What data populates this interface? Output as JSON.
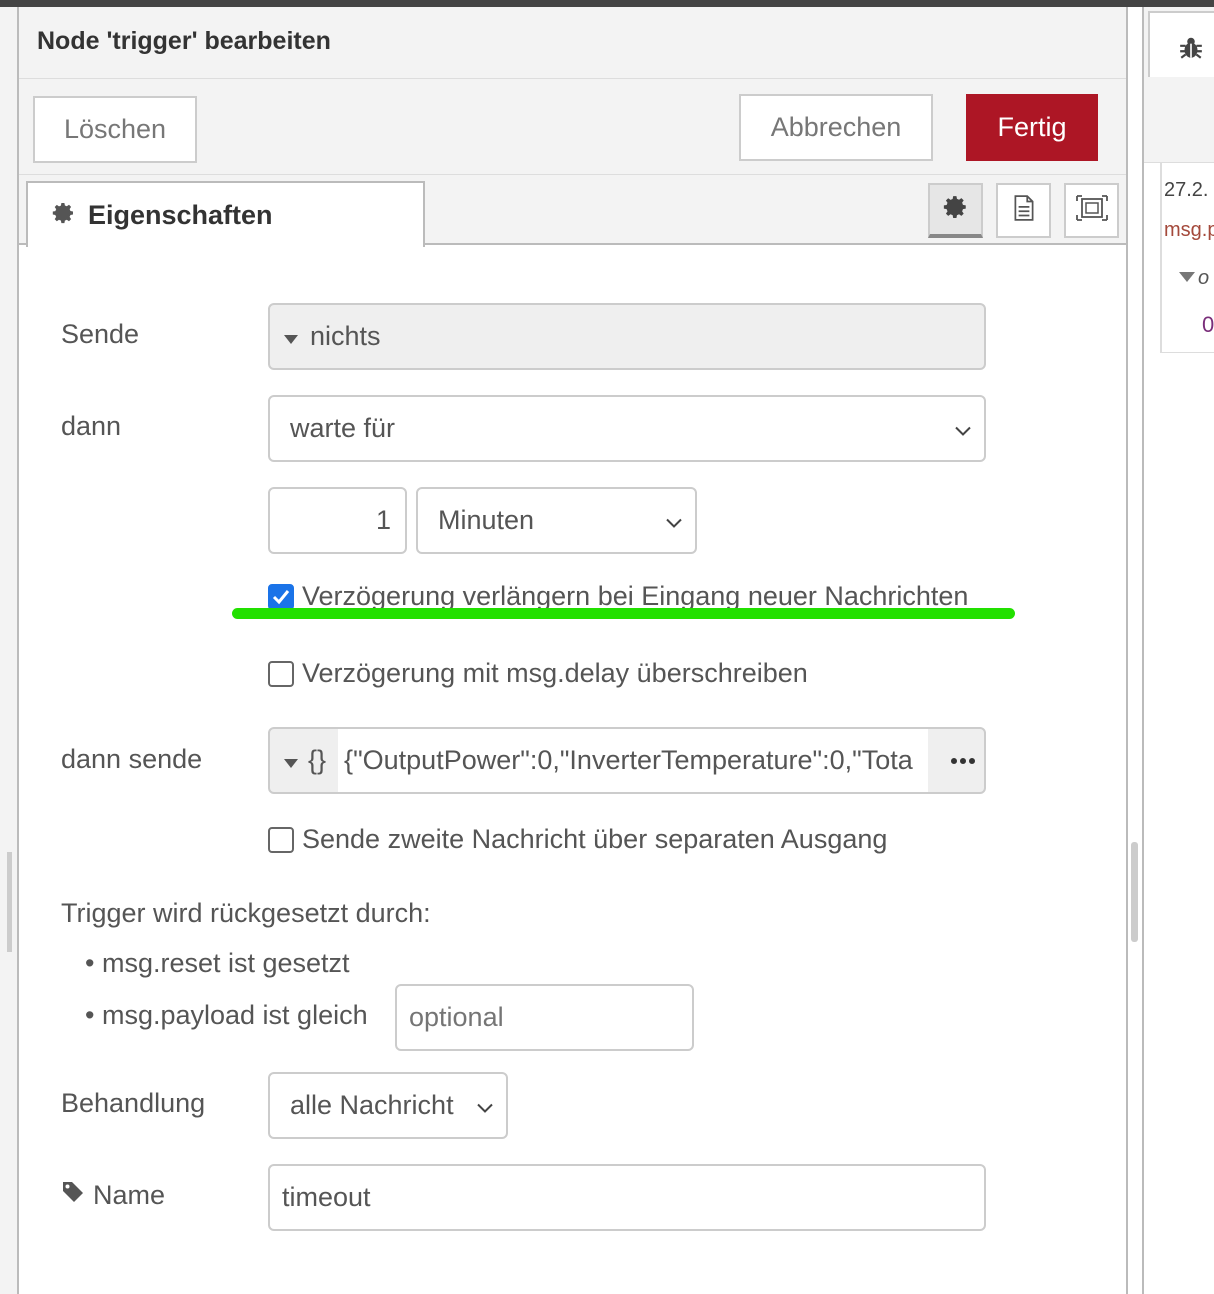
{
  "header": {
    "title": "Node 'trigger' bearbeiten"
  },
  "toolbar": {
    "delete_label": "Löschen",
    "cancel_label": "Abbrechen",
    "done_label": "Fertig"
  },
  "tabs": {
    "properties_label": "Eigenschaften"
  },
  "form": {
    "send_label": "Sende",
    "send_value": "nichts",
    "then_label": "dann",
    "then_value": "warte für",
    "duration_value": "1",
    "units_value": "Minuten",
    "extend_delay_label": "Verzögerung verlängern bei Eingang neuer Nachrichten",
    "extend_delay_checked": true,
    "override_delay_label": "Verzögerung mit msg.delay überschreiben",
    "override_delay_checked": false,
    "then_send_label": "dann sende",
    "then_send_type": "{}",
    "then_send_value": "{\"OutputPower\":0,\"InverterTemperature\":0,\"Tota",
    "second_output_label": "Sende zweite Nachricht über separaten Ausgang",
    "second_output_checked": false,
    "reset_heading": "Trigger wird rückgesetzt durch:",
    "reset_item1": "msg.reset ist gesetzt",
    "reset_item2": "msg.payload ist gleich",
    "reset_payload_placeholder": "optional",
    "handling_label": "Behandlung",
    "handling_value": "alle Nachricht",
    "name_label": "Name",
    "name_value": "timeout"
  },
  "debug_panel": {
    "date": "27.2.",
    "msg": "msg.p",
    "obj": "o",
    "val": "0"
  },
  "colors": {
    "accent": "#ad1625",
    "underline": "#22e000",
    "checkbox": "#1a73e8"
  }
}
